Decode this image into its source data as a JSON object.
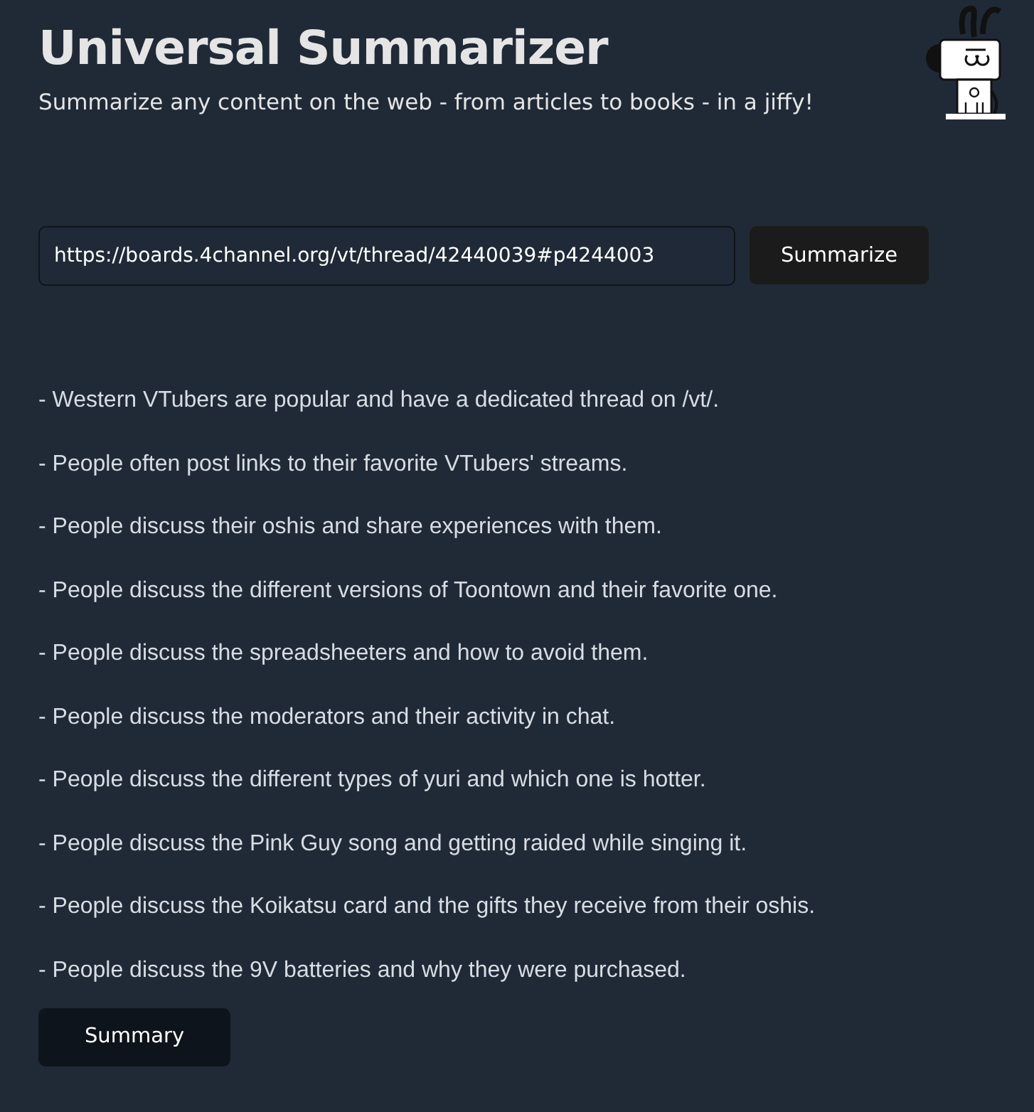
{
  "header": {
    "title": "Universal Summarizer",
    "subtitle": "Summarize any content on the web - from articles to books - in a jiffy!"
  },
  "form": {
    "url": "https://boards.4channel.org/vt/thread/42440039#p4244003",
    "button": "Summarize"
  },
  "summary_lines": [
    "- Western VTubers are popular and have a dedicated thread on /vt/.",
    "- People often post links to their favorite VTubers' streams.",
    "- People discuss their oshis and share experiences with them.",
    "- People discuss the different versions of Toontown and their favorite one.",
    "- People discuss the spreadsheeters and how to avoid them.",
    "- People discuss the moderators and their activity in chat.",
    "- People discuss the different types of yuri and which one is hotter.",
    "- People discuss the Pink Guy song and getting raided while singing it.",
    "- People discuss the Koikatsu card and the gifts they receive from their oshis.",
    "- People discuss the 9V batteries and why they were purchased."
  ],
  "footer_button": "Summary"
}
